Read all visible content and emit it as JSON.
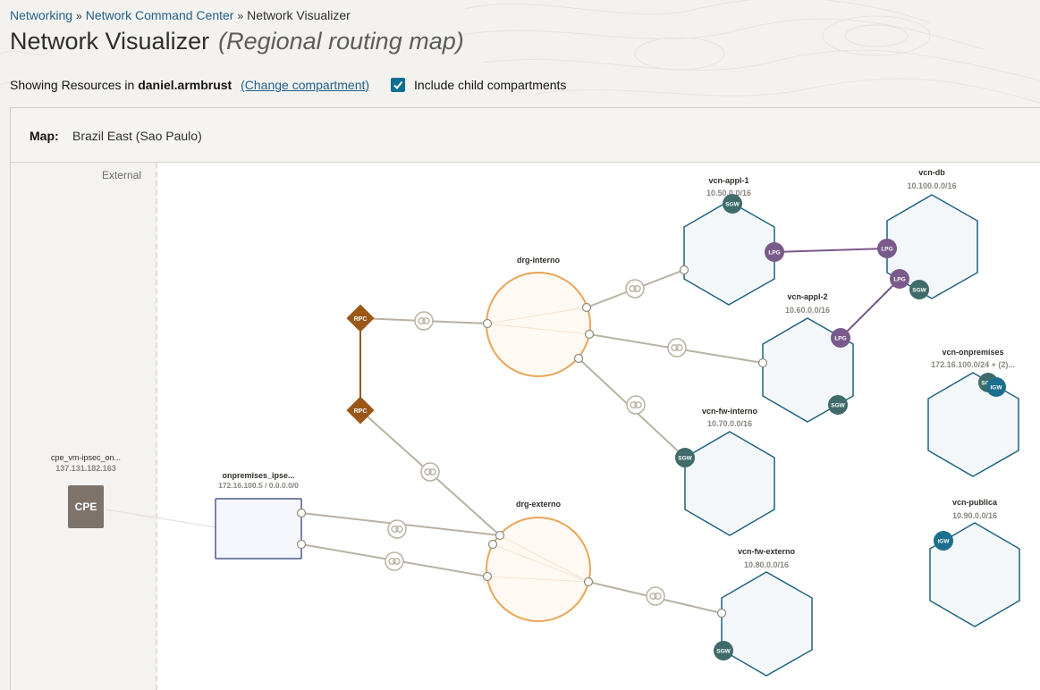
{
  "breadcrumb": {
    "items": [
      "Networking",
      "Network Command Center"
    ],
    "current": "Network Visualizer",
    "separator": "»"
  },
  "page": {
    "title": "Network Visualizer",
    "subtitle": "(Regional routing map)"
  },
  "scope": {
    "prefix": "Showing Resources in",
    "compartment": "daniel.armbrust",
    "change_link": "(Change compartment)",
    "include_child_label": "Include child compartments",
    "include_child_checked": true
  },
  "map": {
    "label": "Map:",
    "region": "Brazil East (Sao Paulo)"
  },
  "external": {
    "label": "External"
  },
  "colors": {
    "link": "#1f5f8b",
    "vcn_stroke": "#1e6380",
    "vcn_fill": "#f3f7fa",
    "drg_stroke": "#eaa558",
    "drg_fill": "#fef9f2",
    "rpc": "#9a5718",
    "lpg": "#7a5a8b",
    "sgw": "#3f6b6b",
    "igw": "#1b6f8f",
    "cpe": "#7d736b",
    "connector": "#b9b2a1"
  },
  "nodes": {
    "cpe": {
      "name": "cpe_vm-ipsec_on...",
      "ip": "137.131.182.163",
      "label": "CPE"
    },
    "ipsec": {
      "name": "onpremises_ipse...",
      "cidr": "172.16.100.5 / 0.0.0.0/0"
    },
    "drg_interno": {
      "name": "drg-interno"
    },
    "drg_externo": {
      "name": "drg-externo"
    },
    "rpc_top": {
      "label": "RPC"
    },
    "rpc_bottom": {
      "label": "RPC"
    },
    "vcn_appl_1": {
      "name": "vcn-appl-1",
      "cidr": "10.50.0.0/16"
    },
    "vcn_db": {
      "name": "vcn-db",
      "cidr": "10.100.0.0/16"
    },
    "vcn_appl_2": {
      "name": "vcn-appl-2",
      "cidr": "10.60.0.0/16"
    },
    "vcn_onpremises": {
      "name": "vcn-onpremises",
      "cidr": "172.16.100.0/24 + (2)..."
    },
    "vcn_fw_interno": {
      "name": "vcn-fw-interno",
      "cidr": "10.70.0.0/16"
    },
    "vcn_publica": {
      "name": "vcn-publica",
      "cidr": "10.90.0.0/16"
    },
    "vcn_fw_externo": {
      "name": "vcn-fw-externo",
      "cidr": "10.80.0.0/16"
    }
  },
  "gateway_labels": {
    "sgw": "SGW",
    "lpg": "LPG",
    "igw": "IGW"
  }
}
